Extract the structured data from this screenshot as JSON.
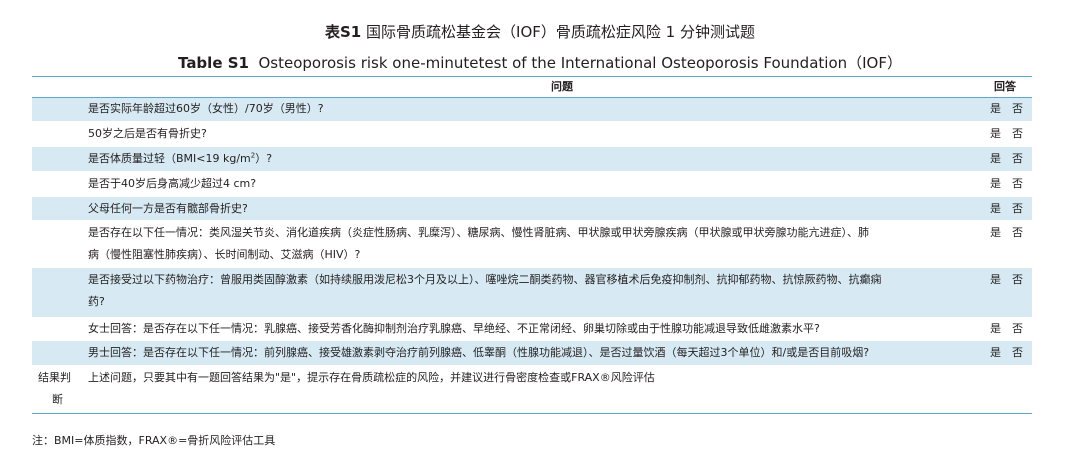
{
  "title": {
    "cn_label": "表S1",
    "cn_text": "国际骨质疏松基金会（IOF）骨质疏松症风险 1 分钟测试题",
    "en_label": "Table S1",
    "en_text": "Osteoporosis risk one-minutetest of the International Osteoporosis Foundation（IOF）"
  },
  "table": {
    "header_question": "问题",
    "header_answer": "回答",
    "yes": "是",
    "no": "否",
    "questions": [
      {
        "line1": "是否实际年龄超过60岁（女性）/70岁（男性）?",
        "line2": ""
      },
      {
        "line1": "50岁之后是否有骨折史?",
        "line2": ""
      },
      {
        "line1": "是否体质量过轻（BMI<19 kg/m",
        "sup": "2",
        "tail": "）?",
        "line2": ""
      },
      {
        "line1": "是否于40岁后身高减少超过4 cm?",
        "line2": ""
      },
      {
        "line1": "父母任何一方是否有髋部骨折史?",
        "line2": ""
      },
      {
        "line1": "是否存在以下任一情况：类风湿关节炎、消化道疾病（炎症性肠病、乳糜泻）、糖尿病、慢性肾脏病、甲状腺或甲状旁腺疾病（甲状腺或甲状旁腺功能亢进症）、肺",
        "line2": "病（慢性阻塞性肺疾病）、长时间制动、艾滋病（HIV）?"
      },
      {
        "line1": "是否接受过以下药物治疗：曾服用类固醇激素（如持续服用泼尼松3个月及以上）、噻唑烷二酮类药物、器官移植术后免疫抑制剂、抗抑郁药物、抗惊厥药物、抗癫痫",
        "line2": "药?"
      },
      {
        "line1": "女士回答：是否存在以下任一情况：乳腺癌、接受芳香化酶抑制剂治疗乳腺癌、早绝经、不正常闭经、卵巢切除或由于性腺功能减退导致低雌激素水平?",
        "line2": ""
      },
      {
        "line1": "男士回答：是否存在以下任一情况：前列腺癌、接受雄激素剥夺治疗前列腺癌、低睾酮（性腺功能减退）、是否过量饮酒（每天超过3个单位）和/或是否目前吸烟?",
        "line2": ""
      }
    ],
    "result_label_1": "结果判",
    "result_label_2": "断",
    "result_text": "上述问题，只要其中有一题回答结果为\"是\"，提示存在骨质疏松症的风险，并建议进行骨密度检查或FRAX®风险评估"
  },
  "note": "注：BMI=体质指数，FRAX®=骨折风险评估工具",
  "colors": {
    "accent_line": "#5fa7c4",
    "row_shade": "#d7eaf3"
  }
}
